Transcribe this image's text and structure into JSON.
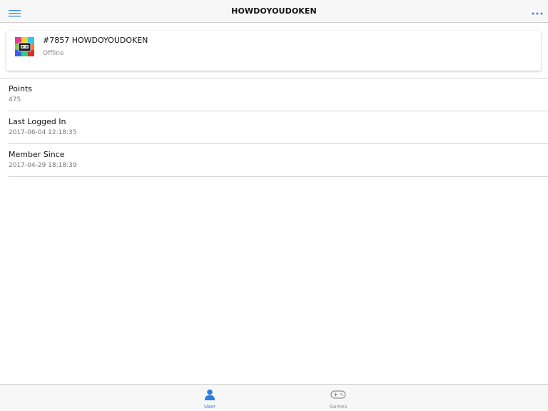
{
  "navbar": {
    "title": "HOWDOYOUDOKEN",
    "menu_icon": "hamburger-menu-icon",
    "more_icon": "more-dots-icon"
  },
  "profile": {
    "name": "#7857 HOWDOYOUDOKEN",
    "status": "Offline",
    "avatar_icon": "colorful-console-avatar"
  },
  "info": {
    "items": [
      {
        "label": "Points",
        "value": "475"
      },
      {
        "label": "Last Logged In",
        "value": "2017-06-04 12:18:35"
      },
      {
        "label": "Member Since",
        "value": "2017-04-29 18:18:39"
      }
    ]
  },
  "tabs": {
    "items": [
      {
        "label": "User",
        "icon": "user-icon",
        "active": true
      },
      {
        "label": "Games",
        "icon": "gamepad-icon",
        "active": false
      }
    ]
  },
  "colors": {
    "accent": "#2f7de1",
    "inactive": "#8e8e8e",
    "bar_background": "#f7f7f7",
    "divider": "#d4d4d4"
  }
}
